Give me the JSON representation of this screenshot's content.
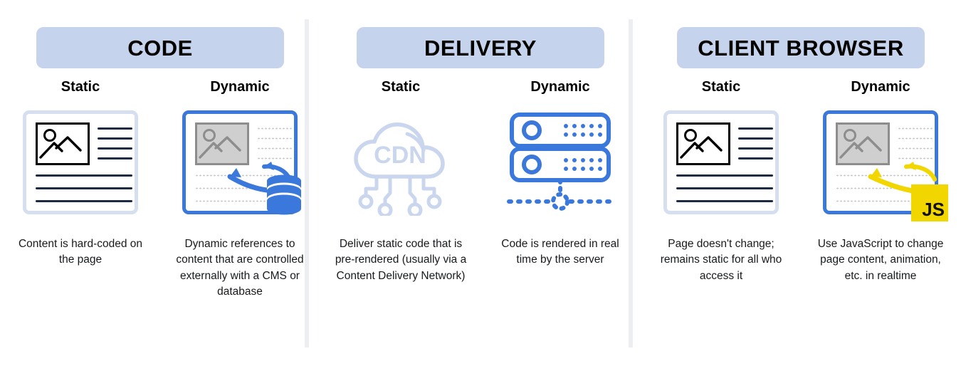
{
  "columns": [
    {
      "header": "CODE",
      "panes": [
        {
          "title": "Static",
          "icon": "static-page-icon",
          "caption": "Content is hard-coded on the page"
        },
        {
          "title": "Dynamic",
          "icon": "dynamic-page-database-icon",
          "caption": "Dynamic references to content that are controlled externally with a CMS or database"
        }
      ]
    },
    {
      "header": "DELIVERY",
      "panes": [
        {
          "title": "Static",
          "icon": "cdn-cloud-icon",
          "icon_label": "CDN",
          "caption": "Deliver static code that is pre-rendered (usually via a Content Delivery Network)"
        },
        {
          "title": "Dynamic",
          "icon": "server-rack-icon",
          "caption": "Code is rendered in real time by the server"
        }
      ]
    },
    {
      "header": "CLIENT BROWSER",
      "panes": [
        {
          "title": "Static",
          "icon": "static-page-icon",
          "caption": "Page doesn't change; remains static for all who access it"
        },
        {
          "title": "Dynamic",
          "icon": "dynamic-page-javascript-icon",
          "icon_label": "JS",
          "caption": "Use JavaScript to change page content, animation, etc. in realtime"
        }
      ]
    }
  ],
  "colors": {
    "pill_background": "#c5d3ec",
    "accent_blue": "#3b78dc",
    "cdn_light_blue": "#c9d6ee",
    "js_yellow": "#f2d600",
    "static_border": "#d5dfef",
    "text_dark": "#17191c",
    "divider": "#eceef1",
    "line_navy": "#1d2a44",
    "dotted_gray": "#c9c9c9"
  }
}
